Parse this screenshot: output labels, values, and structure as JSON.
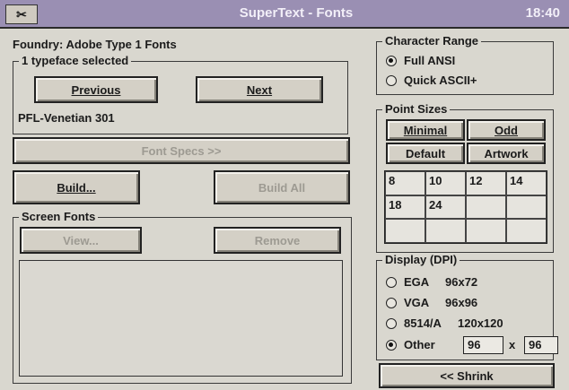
{
  "titlebar": {
    "title": "SuperText - Fonts",
    "clock": "18:40",
    "sysmenu_glyph": "✂"
  },
  "foundry": {
    "label": "Foundry: Adobe Type 1 Fonts"
  },
  "typeface_group": {
    "legend": "1 typeface selected",
    "previous_label": "Previous",
    "next_label": "Next",
    "selected_font": "PFL-Venetian 301"
  },
  "buttons": {
    "font_specs": "Font Specs >>",
    "build": "Build...",
    "build_all": "Build All"
  },
  "screen_fonts": {
    "legend": "Screen Fonts",
    "view_label": "View...",
    "remove_label": "Remove",
    "list_items": []
  },
  "character_range": {
    "legend": "Character Range",
    "options": [
      {
        "label": "Full ANSI",
        "selected": true
      },
      {
        "label": "Quick ASCII+",
        "selected": false
      }
    ]
  },
  "point_sizes": {
    "legend": "Point Sizes",
    "minimal_label": "Minimal",
    "odd_label": "Odd",
    "default_label": "Default",
    "artwork_label": "Artwork",
    "sizes": [
      "8",
      "10",
      "12",
      "14",
      "18",
      "24",
      "",
      "",
      "",
      "",
      "",
      ""
    ]
  },
  "display": {
    "legend": "Display (DPI)",
    "options": [
      {
        "name": "EGA",
        "value": "96x72",
        "selected": false
      },
      {
        "name": "VGA",
        "value": "96x96",
        "selected": false
      },
      {
        "name": "8514/A",
        "value": "120x120",
        "selected": false
      },
      {
        "name": "Other",
        "value": "",
        "selected": true
      }
    ],
    "other_x": "96",
    "separator": "x",
    "other_y": "96"
  },
  "shrink_label": "<< Shrink",
  "colors": {
    "titlebar": "#9a8fb3",
    "background": "#d9d7cf",
    "disabled_text": "#9d9a92"
  }
}
